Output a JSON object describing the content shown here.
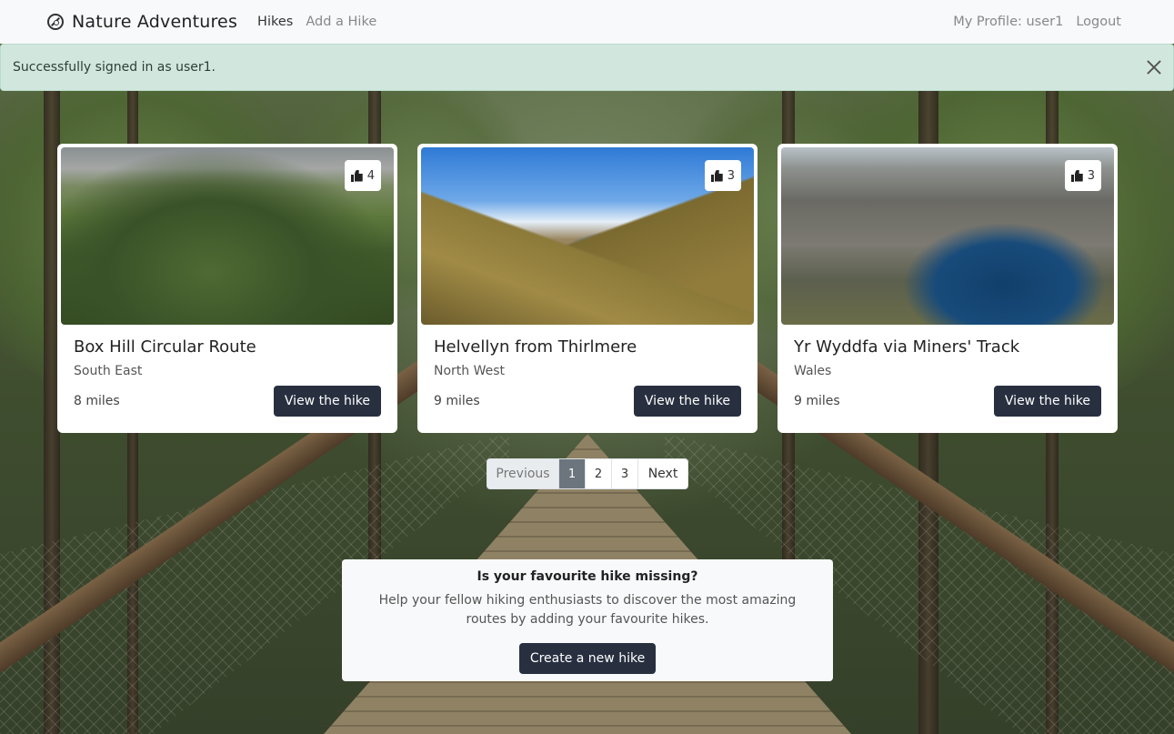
{
  "navbar": {
    "brand": "Nature Adventures",
    "brand_icon": "compass-icon",
    "links": [
      {
        "label": "Hikes",
        "active": true
      },
      {
        "label": "Add a Hike",
        "active": false
      }
    ],
    "right_links": [
      {
        "label": "My Profile: user1"
      },
      {
        "label": "Logout"
      }
    ]
  },
  "alert": {
    "message": "Successfully signed in as user1.",
    "close_icon": "close-icon"
  },
  "hikes": [
    {
      "title": "Box Hill Circular Route",
      "region": "South East",
      "distance": "8 miles",
      "likes": "4",
      "button": "View the hike"
    },
    {
      "title": "Helvellyn from Thirlmere",
      "region": "North West",
      "distance": "9 miles",
      "likes": "3",
      "button": "View the hike"
    },
    {
      "title": "Yr Wyddfa via Miners' Track",
      "region": "Wales",
      "distance": "9 miles",
      "likes": "3",
      "button": "View the hike"
    }
  ],
  "pagination": {
    "previous": "Previous",
    "pages": [
      "1",
      "2",
      "3"
    ],
    "current": "1",
    "next": "Next"
  },
  "cta": {
    "title": "Is your favourite hike missing?",
    "text": "Help your fellow hiking enthusiasts to discover the most amazing routes by adding your favourite hikes.",
    "button": "Create a new hike"
  },
  "colors": {
    "navbar_bg": "#f8f9fa",
    "alert_bg": "#d1e7dd",
    "button_dark": "#283040",
    "active_page": "#6c757d"
  }
}
